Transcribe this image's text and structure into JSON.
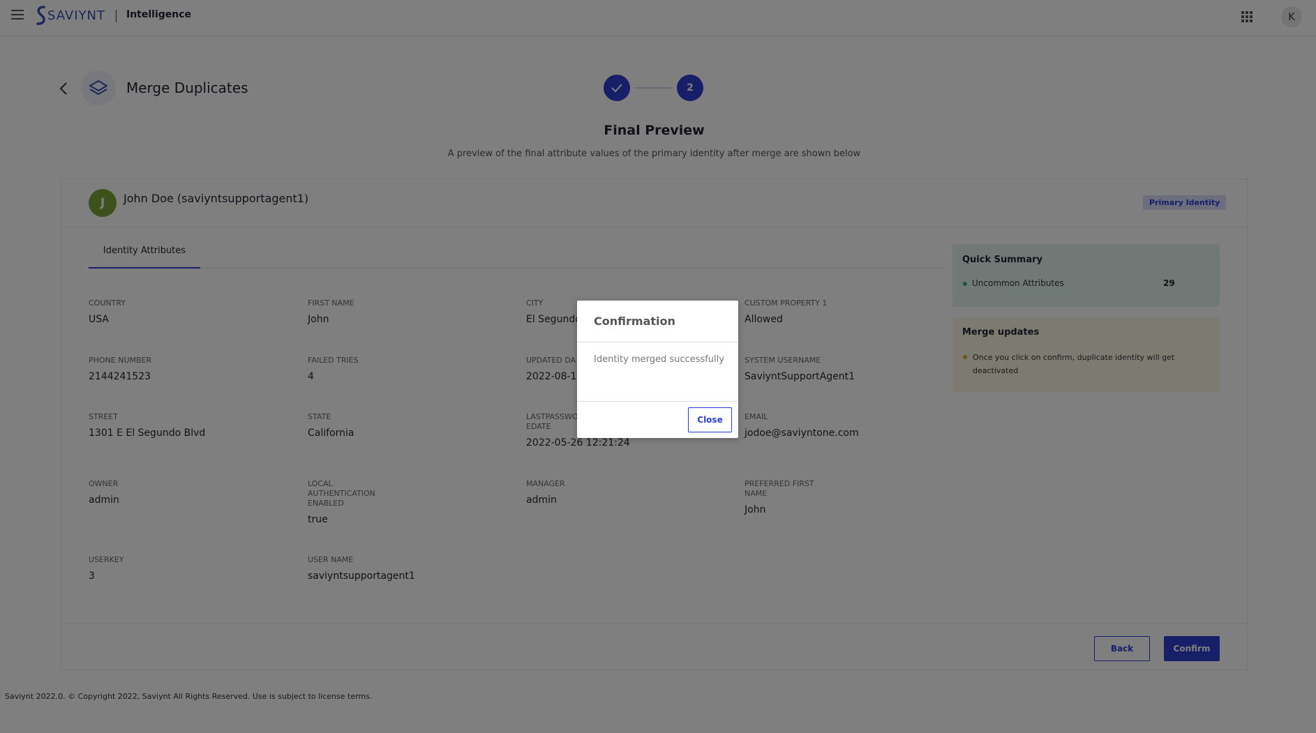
{
  "header": {
    "brand": "SAVIYNT",
    "app_name": "Intelligence",
    "user_initial": "K"
  },
  "page": {
    "title": "Merge Duplicates",
    "steps": [
      {
        "state": "complete",
        "icon": "check-icon"
      },
      {
        "state": "current",
        "label": "2"
      }
    ],
    "section_title": "Final Preview",
    "section_subtitle": "A preview of the final attribute values of the primary identity after merge are shown below"
  },
  "identity": {
    "initial": "J",
    "name": "John Doe (saviyntsupportagent1)",
    "badge": "Primary Identity"
  },
  "tabs": [
    {
      "label": "Identity Attributes",
      "active": true
    }
  ],
  "attributes": [
    {
      "label": "COUNTRY",
      "value": "USA"
    },
    {
      "label": "FIRST NAME",
      "value": "John"
    },
    {
      "label": "CITY",
      "value": "El Segundo"
    },
    {
      "label": "CUSTOM PROPERTY 1",
      "value": "Allowed"
    },
    {
      "label": "PHONE NUMBER",
      "value": "2144241523"
    },
    {
      "label": "FAILED TRIES",
      "value": "4"
    },
    {
      "label": "UPDATED DA",
      "value": "2022-08-1"
    },
    {
      "label": "SYSTEM USERNAME",
      "value": "SaviyntSupportAgent1"
    },
    {
      "label": "STREET",
      "value": "1301 E El Segundo Blvd"
    },
    {
      "label": "STATE",
      "value": "California"
    },
    {
      "label": "LASTPASSWO EDATE",
      "value": "2022-05-26 12:21:24"
    },
    {
      "label": "EMAIL",
      "value": "jodoe@saviyntone.com"
    },
    {
      "label": "OWNER",
      "value": "admin"
    },
    {
      "label": "LOCAL AUTHENTICATION ENABLED",
      "value": "true"
    },
    {
      "label": "MANAGER",
      "value": "admin"
    },
    {
      "label": "PREFERRED FIRST NAME",
      "value": "John"
    },
    {
      "label": "USERKEY",
      "value": "3"
    },
    {
      "label": "USER NAME",
      "value": "saviyntsupportagent1"
    }
  ],
  "quick_summary": {
    "title": "Quick Summary",
    "item_label": "Uncommon Attributes",
    "item_count": "29"
  },
  "merge_updates": {
    "title": "Merge updates",
    "text": "Once you click on confirm, duplicate identity will get deactivated"
  },
  "actions": {
    "back": "Back",
    "confirm": "Confirm"
  },
  "footer": {
    "copyright": "Saviynt 2022.0. © Copyright 2022, Saviynt All Rights Reserved. Use is subject to license terms."
  },
  "modal": {
    "title": "Confirmation",
    "message": "Identity merged successfully",
    "close": "Close"
  },
  "colors": {
    "primary": "#2c3ed0",
    "avatar_green": "#7aa23a",
    "summary_bg": "#e3f2ec",
    "merge_bg": "#fbf4e5"
  }
}
